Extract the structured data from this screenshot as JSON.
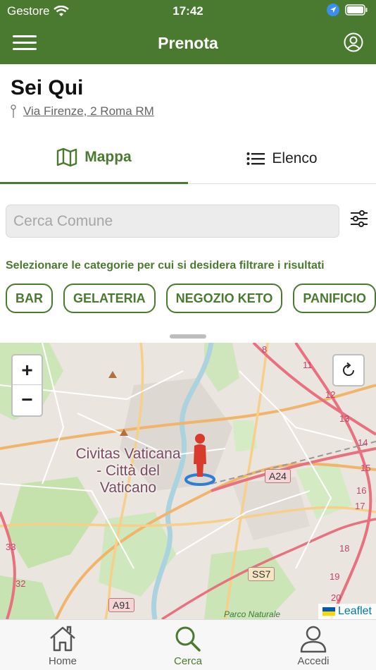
{
  "status_bar": {
    "carrier": "Gestore",
    "time": "17:42"
  },
  "header": {
    "title": "Prenota"
  },
  "location": {
    "title": "Sei Qui",
    "address": "Via Firenze, 2 Roma RM"
  },
  "tabs": [
    {
      "label": "Mappa",
      "active": true
    },
    {
      "label": "Elenco",
      "active": false
    }
  ],
  "search": {
    "placeholder": "Cerca Comune",
    "value": ""
  },
  "filter_hint": "Selezionare le categorie per cui si desidera filtrare i risultati",
  "categories": [
    "BAR",
    "GELATERIA",
    "NEGOZIO KETO",
    "PANIFICIO"
  ],
  "map": {
    "zoom_in": "+",
    "zoom_out": "−",
    "area_label": [
      "Civitas Vaticana",
      "- Città del",
      "Vaticano"
    ],
    "roads": [
      "A24",
      "SS7",
      "A91"
    ],
    "km_markers": [
      "8",
      "11",
      "12",
      "13",
      "14",
      "15",
      "16",
      "17",
      "18",
      "19",
      "20",
      "32",
      "33"
    ],
    "park_label": "Parco Naturale",
    "attribution": "Leaflet"
  },
  "bottom_tabs": [
    {
      "label": "Home",
      "icon": "home-icon",
      "active": false
    },
    {
      "label": "Cerca",
      "icon": "search-icon",
      "active": true
    },
    {
      "label": "Accedi",
      "icon": "user-icon",
      "active": false
    }
  ],
  "colors": {
    "primary": "#4a7a2f",
    "map_bg": "#eae6df",
    "marker": "#d83a2e"
  }
}
